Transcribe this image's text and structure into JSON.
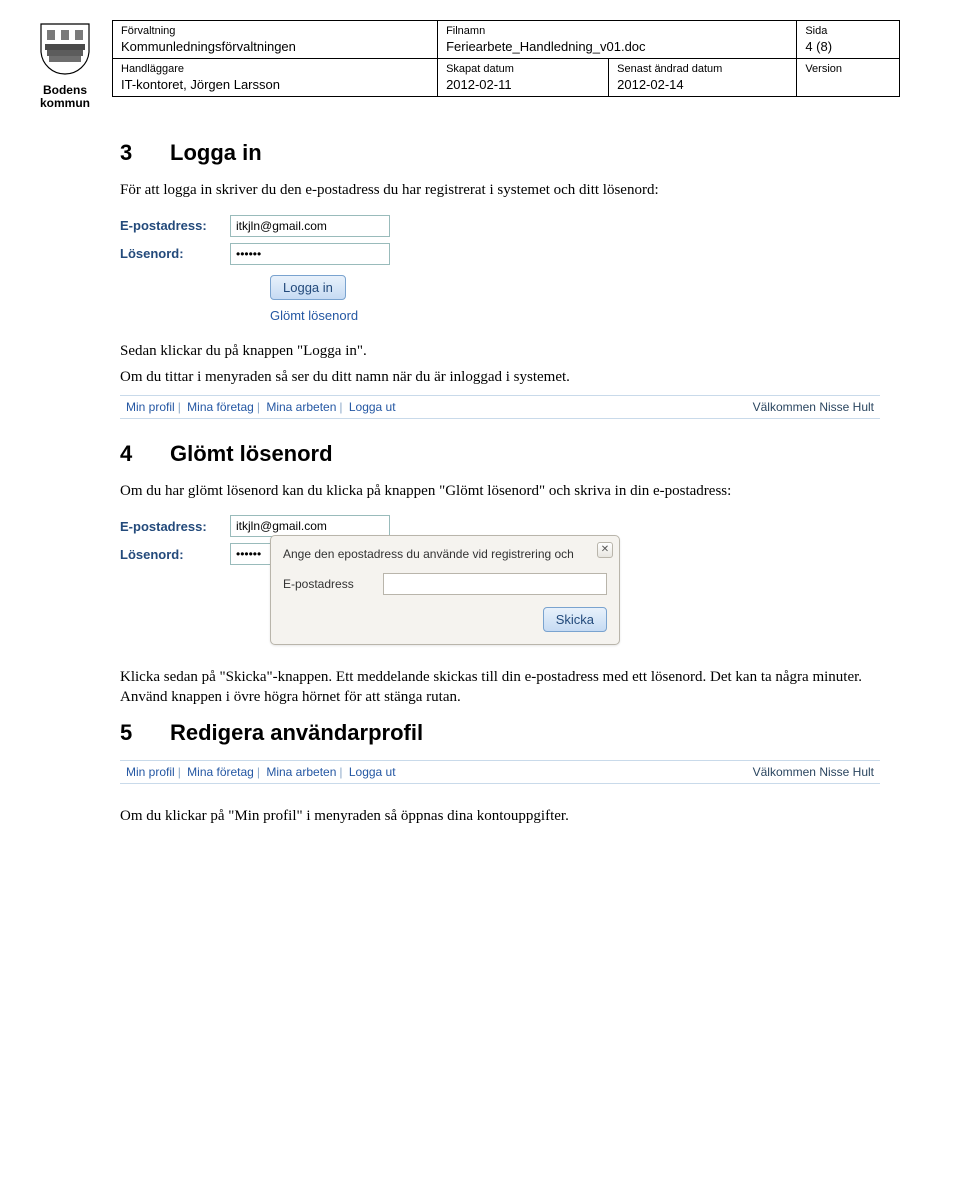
{
  "meta": {
    "row1": {
      "c1_label": "Förvaltning",
      "c1_value": "Kommunledningsförvaltningen",
      "c2_label": "Filnamn",
      "c2_value": "Feriearbete_Handledning_v01.doc",
      "c3_label": "Sida",
      "c3_value": "4 (8)"
    },
    "row2": {
      "c1_label": "Handläggare",
      "c1_value": "IT-kontoret, Jörgen Larsson",
      "c2_label": "Skapat datum",
      "c2_value": "2012-02-11",
      "c3_label": "Senast ändrad datum",
      "c3_value": "2012-02-14",
      "c4_label": "Version",
      "c4_value": ""
    }
  },
  "logo": {
    "line1": "Bodens",
    "line2": "kommun"
  },
  "s3": {
    "num": "3",
    "title": "Logga in",
    "p1": "För att logga in skriver du den e-postadress du har registrerat i systemet och ditt lösenord:",
    "p2": "Sedan klickar du på knappen \"Logga in\".",
    "p3": "Om du tittar i menyraden så ser du ditt namn när du är inloggad i systemet."
  },
  "login": {
    "email_label": "E-postadress:",
    "email_value": "itkjln@gmail.com",
    "pwd_label": "Lösenord:",
    "pwd_value": "••••••",
    "btn": "Logga in",
    "forgot": "Glömt lösenord"
  },
  "menu": {
    "i1": "Min profil",
    "i2": "Mina företag",
    "i3": "Mina arbeten",
    "i4": "Logga ut",
    "welcome": "Välkommen Nisse Hult"
  },
  "s4": {
    "num": "4",
    "title": "Glömt lösenord",
    "p1": "Om du har glömt lösenord kan du klicka på knappen \"Glömt lösenord\" och skriva in din e-postadress:",
    "p2": "Klicka sedan på \"Skicka\"-knappen. Ett meddelande skickas till din e-postadress med ett lösenord. Det kan ta några minuter. Använd knappen i övre högra hörnet för att stänga rutan."
  },
  "popup": {
    "msg": "Ange den epostadress du använde vid registrering och",
    "email_label": "E-postadress",
    "btn": "Skicka",
    "close": "✕"
  },
  "s5": {
    "num": "5",
    "title": "Redigera användarprofil",
    "p1": "Om du klickar på \"Min profil\" i menyraden så öppnas dina kontouppgifter."
  }
}
